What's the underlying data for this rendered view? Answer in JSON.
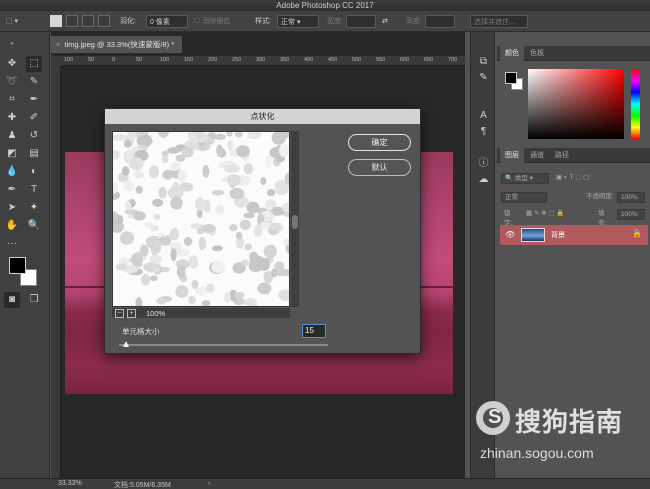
{
  "app": {
    "window_title": "Adobe Photoshop CC 2017"
  },
  "options_bar": {
    "feather_label": "羽化:",
    "feather_value": "0 像素",
    "antialias_label": "消除锯齿",
    "style_label": "样式:",
    "style_value": "正常",
    "width_label": "宽度:",
    "height_label": "高度:",
    "select_and_mask": "选择并遮住..."
  },
  "document": {
    "tab_title": "timg.jpeg @ 33.3%(快速蒙版/8) *",
    "ruler_ticks": [
      "100",
      "50",
      "0",
      "50",
      "100",
      "150",
      "200",
      "250",
      "300",
      "350",
      "400",
      "450",
      "500",
      "550",
      "600",
      "650",
      "700"
    ]
  },
  "status_bar": {
    "zoom": "33.33%",
    "doc_size": "文档:5.05M/6.35M"
  },
  "panels": {
    "color_tab": "颜色",
    "swatches_tab": "色板",
    "layers_tab": "图层",
    "channels_tab": "通道",
    "paths_tab": "路径",
    "kind_filter": "类型",
    "blend_mode": "正常",
    "opacity_label": "不透明度:",
    "opacity_value": "100%",
    "lock_label": "锁定:",
    "fill_label": "填充:",
    "fill_value": "100%",
    "layer_name": "背景"
  },
  "dialog": {
    "title": "点状化",
    "ok_button": "确定",
    "default_button": "默认",
    "zoom_level": "100%",
    "cell_size_label": "单元格大小",
    "cell_size_value": "15",
    "cell_size_fraction": 0.0
  },
  "watermark": {
    "brand_cn": "搜狗指南",
    "url": "zhinan.sogou.com"
  },
  "colors": {
    "fg": "#000000",
    "bg": "#ffffff",
    "layer_highlight": "#b2595d"
  }
}
